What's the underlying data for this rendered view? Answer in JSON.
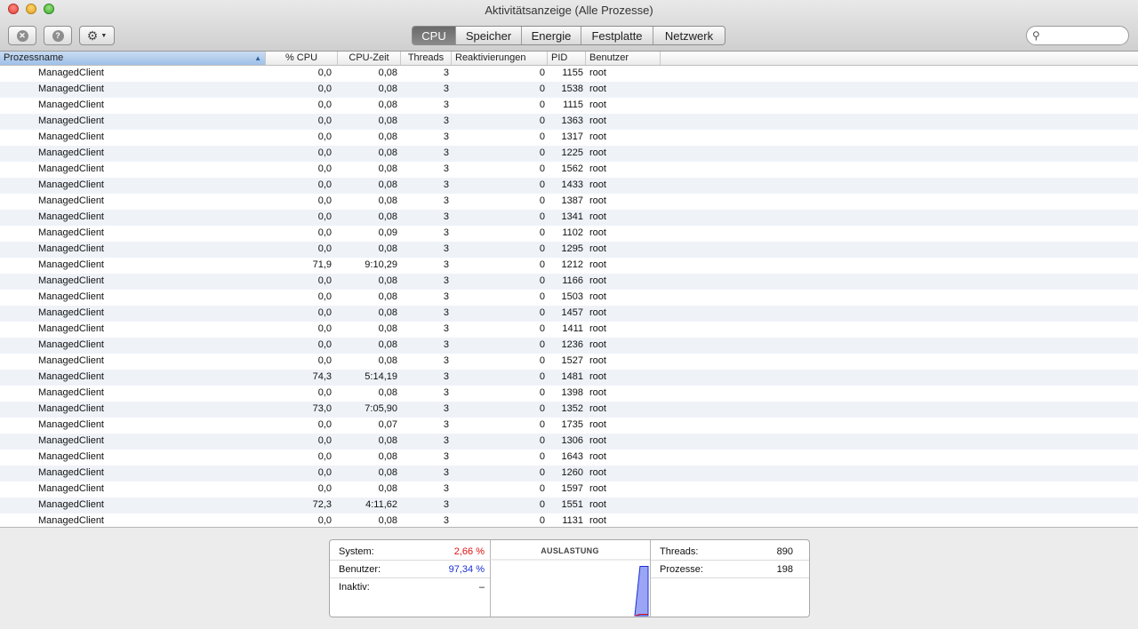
{
  "window": {
    "title": "Aktivitätsanzeige (Alle Prozesse)"
  },
  "toolbar": {
    "buttons": [
      "close-process-icon",
      "info-icon",
      "gear-icon"
    ],
    "tabs": [
      "CPU",
      "Speicher",
      "Energie",
      "Festplatte",
      "Netzwerk"
    ],
    "active_tab": "CPU",
    "search_placeholder": ""
  },
  "table": {
    "columns": [
      "Prozessname",
      "% CPU",
      "CPU-Zeit",
      "Threads",
      "Reaktivierungen",
      "PID",
      "Benutzer"
    ],
    "sorted_column": "Prozessname",
    "sort_direction": "ascending",
    "rows": [
      [
        "ManagedClient",
        "0,0",
        "0,08",
        "3",
        "0",
        "1155",
        "root"
      ],
      [
        "ManagedClient",
        "0,0",
        "0,08",
        "3",
        "0",
        "1538",
        "root"
      ],
      [
        "ManagedClient",
        "0,0",
        "0,08",
        "3",
        "0",
        "1115",
        "root"
      ],
      [
        "ManagedClient",
        "0,0",
        "0,08",
        "3",
        "0",
        "1363",
        "root"
      ],
      [
        "ManagedClient",
        "0,0",
        "0,08",
        "3",
        "0",
        "1317",
        "root"
      ],
      [
        "ManagedClient",
        "0,0",
        "0,08",
        "3",
        "0",
        "1225",
        "root"
      ],
      [
        "ManagedClient",
        "0,0",
        "0,08",
        "3",
        "0",
        "1562",
        "root"
      ],
      [
        "ManagedClient",
        "0,0",
        "0,08",
        "3",
        "0",
        "1433",
        "root"
      ],
      [
        "ManagedClient",
        "0,0",
        "0,08",
        "3",
        "0",
        "1387",
        "root"
      ],
      [
        "ManagedClient",
        "0,0",
        "0,08",
        "3",
        "0",
        "1341",
        "root"
      ],
      [
        "ManagedClient",
        "0,0",
        "0,09",
        "3",
        "0",
        "1102",
        "root"
      ],
      [
        "ManagedClient",
        "0,0",
        "0,08",
        "3",
        "0",
        "1295",
        "root"
      ],
      [
        "ManagedClient",
        "71,9",
        "9:10,29",
        "3",
        "0",
        "1212",
        "root"
      ],
      [
        "ManagedClient",
        "0,0",
        "0,08",
        "3",
        "0",
        "1166",
        "root"
      ],
      [
        "ManagedClient",
        "0,0",
        "0,08",
        "3",
        "0",
        "1503",
        "root"
      ],
      [
        "ManagedClient",
        "0,0",
        "0,08",
        "3",
        "0",
        "1457",
        "root"
      ],
      [
        "ManagedClient",
        "0,0",
        "0,08",
        "3",
        "0",
        "1411",
        "root"
      ],
      [
        "ManagedClient",
        "0,0",
        "0,08",
        "3",
        "0",
        "1236",
        "root"
      ],
      [
        "ManagedClient",
        "0,0",
        "0,08",
        "3",
        "0",
        "1527",
        "root"
      ],
      [
        "ManagedClient",
        "74,3",
        "5:14,19",
        "3",
        "0",
        "1481",
        "root"
      ],
      [
        "ManagedClient",
        "0,0",
        "0,08",
        "3",
        "0",
        "1398",
        "root"
      ],
      [
        "ManagedClient",
        "73,0",
        "7:05,90",
        "3",
        "0",
        "1352",
        "root"
      ],
      [
        "ManagedClient",
        "0,0",
        "0,07",
        "3",
        "0",
        "1735",
        "root"
      ],
      [
        "ManagedClient",
        "0,0",
        "0,08",
        "3",
        "0",
        "1306",
        "root"
      ],
      [
        "ManagedClient",
        "0,0",
        "0,08",
        "3",
        "0",
        "1643",
        "root"
      ],
      [
        "ManagedClient",
        "0,0",
        "0,08",
        "3",
        "0",
        "1260",
        "root"
      ],
      [
        "ManagedClient",
        "0,0",
        "0,08",
        "3",
        "0",
        "1597",
        "root"
      ],
      [
        "ManagedClient",
        "72,3",
        "4:11,62",
        "3",
        "0",
        "1551",
        "root"
      ],
      [
        "ManagedClient",
        "0,0",
        "0,08",
        "3",
        "0",
        "1131",
        "root"
      ]
    ]
  },
  "summary": {
    "system_label": "System:",
    "system_value": "2,66 %",
    "user_label": "Benutzer:",
    "user_value": "97,34 %",
    "idle_label": "Inaktiv:",
    "idle_value": "–",
    "chart_title": "AUSLASTUNG",
    "threads_label": "Threads:",
    "threads_value": "890",
    "processes_label": "Prozesse:",
    "processes_value": "198",
    "colors": {
      "system": "#e01010",
      "user": "#1a2fd6",
      "chart_user_fill": "#9aa6f5",
      "chart_system_line": "#e01010"
    }
  },
  "chart_data": {
    "type": "area",
    "title": "AUSLASTUNG",
    "xlabel": "",
    "ylabel": "",
    "ylim": [
      0,
      100
    ],
    "series": [
      {
        "name": "Benutzer",
        "values": [
          0,
          0,
          0,
          0,
          0,
          0,
          0,
          0,
          0,
          0,
          0,
          0,
          0,
          0,
          0,
          0,
          0,
          0,
          97.34,
          97.34
        ]
      },
      {
        "name": "System",
        "values": [
          0,
          0,
          0,
          0,
          0,
          0,
          0,
          0,
          0,
          0,
          0,
          0,
          0,
          0,
          0,
          0,
          0,
          0,
          2.66,
          2.66
        ]
      }
    ]
  }
}
